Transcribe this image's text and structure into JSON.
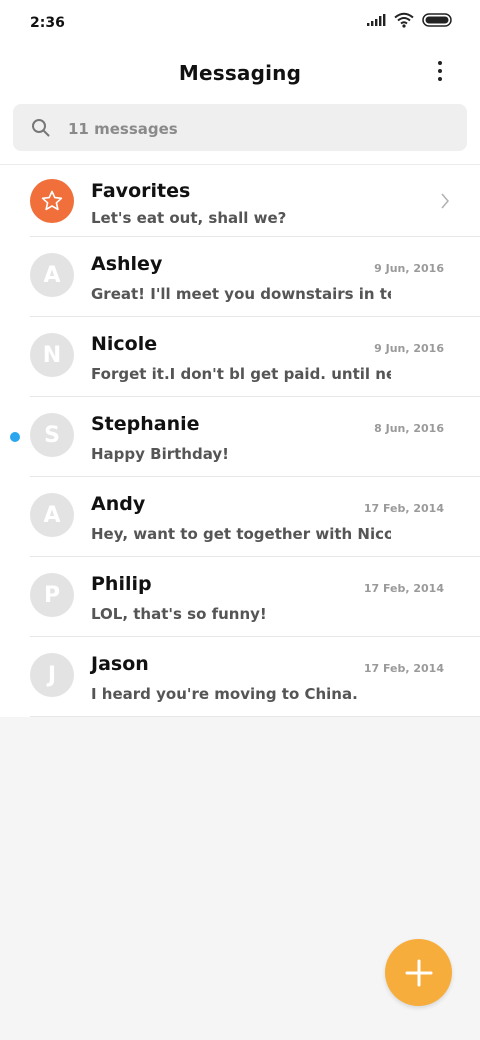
{
  "status_bar": {
    "time": "2:36",
    "icons": [
      "signal-icon",
      "wifi-icon",
      "battery-icon"
    ]
  },
  "header": {
    "title": "Messaging",
    "menu_icon": "more-vertical-icon"
  },
  "search": {
    "icon": "search-icon",
    "placeholder": "11 messages"
  },
  "favorites": {
    "icon": "star-icon",
    "name": "Favorites",
    "preview": "Let's eat out, shall we?",
    "chevron_icon": "chevron-right-icon"
  },
  "conversations": [
    {
      "initial": "A",
      "name": "Ashley",
      "date": "9 Jun, 2016",
      "preview": "Great! I'll meet you downstairs in ten ...",
      "unread": false
    },
    {
      "initial": "N",
      "name": "Nicole",
      "date": "9 Jun, 2016",
      "preview": "Forget it.I don't bl get paid. until next ...",
      "unread": false
    },
    {
      "initial": "S",
      "name": "Stephanie",
      "date": "8 Jun, 2016",
      "preview": "Happy Birthday!",
      "unread": true
    },
    {
      "initial": "A",
      "name": "Andy",
      "date": "17 Feb, 2014",
      "preview": "Hey, want to get together with Nicole ...",
      "unread": false
    },
    {
      "initial": "P",
      "name": "Philip",
      "date": "17 Feb, 2014",
      "preview": "LOL, that's so funny!",
      "unread": false
    },
    {
      "initial": "J",
      "name": "Jason",
      "date": "17 Feb, 2014",
      "preview": "I heard you're moving to China.",
      "unread": false
    }
  ],
  "fab": {
    "icon": "plus-icon"
  },
  "colors": {
    "favorites_avatar": "#f06f3a",
    "fab": "#f6ad3c",
    "unread_dot": "#2aa6ee",
    "avatar_placeholder": "#e3e3e3"
  }
}
